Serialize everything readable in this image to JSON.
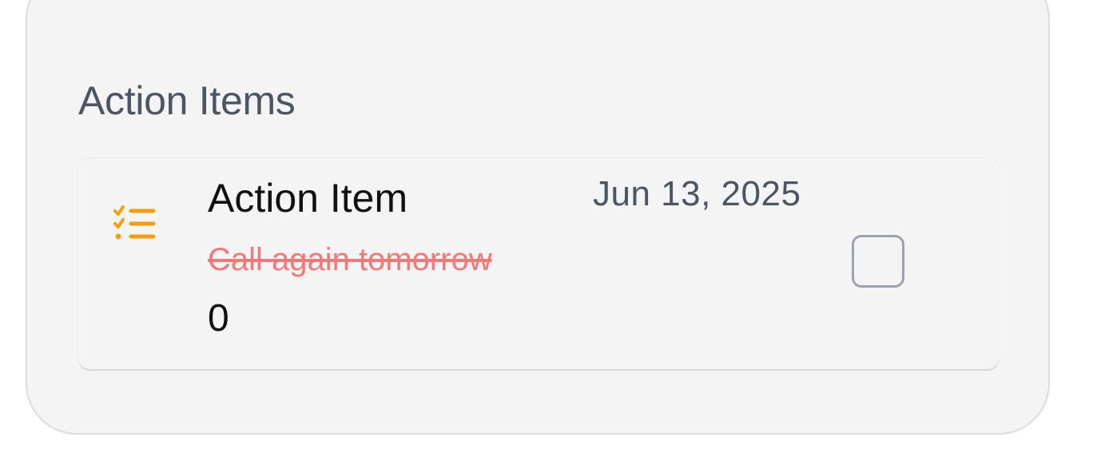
{
  "section": {
    "title": "Action Items"
  },
  "items": [
    {
      "title": "Action Item",
      "date": "Jun 13, 2025",
      "description": "Call again tomorrow",
      "count": "0",
      "icon": "checklist-icon",
      "accent_color": "#f59e0b",
      "description_color": "#f07a7a",
      "completed": false
    }
  ]
}
